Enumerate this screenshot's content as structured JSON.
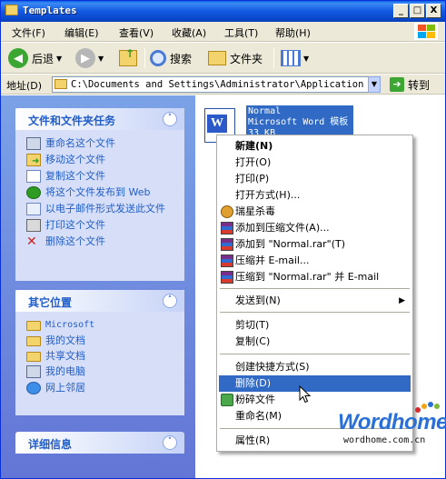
{
  "window": {
    "title": "Templates",
    "minimize": "_",
    "maximize": "□",
    "close": "X"
  },
  "menubar": [
    {
      "label": "文件(F)"
    },
    {
      "label": "编辑(E)"
    },
    {
      "label": "查看(V)"
    },
    {
      "label": "收藏(A)"
    },
    {
      "label": "工具(T)"
    },
    {
      "label": "帮助(H)"
    }
  ],
  "toolbar": {
    "back": "后退",
    "search": "搜索",
    "folders": "文件夹"
  },
  "address": {
    "label": "地址(D)",
    "value": "C:\\Documents and Settings\\Administrator\\Application Data\\Microsoft\\Templates",
    "go": "转到"
  },
  "left": {
    "tasks": {
      "title": "文件和文件夹任务",
      "items": [
        {
          "label": "重命名这个文件"
        },
        {
          "label": "移动这个文件"
        },
        {
          "label": "复制这个文件"
        },
        {
          "label": "将这个文件发布到 Web"
        },
        {
          "label": "以电子邮件形式发送此文件"
        },
        {
          "label": "打印这个文件"
        },
        {
          "label": "删除这个文件"
        }
      ]
    },
    "places": {
      "title": "其它位置",
      "items": [
        {
          "label": "Microsoft"
        },
        {
          "label": "我的文档"
        },
        {
          "label": "共享文档"
        },
        {
          "label": "我的电脑"
        },
        {
          "label": "网上邻居"
        }
      ]
    },
    "details": {
      "title": "详细信息"
    }
  },
  "file": {
    "name": "Normal",
    "type": "Microsoft Word 模板",
    "size": "33 KB"
  },
  "context_menu": {
    "items": [
      {
        "label": "新建(N)"
      },
      {
        "label": "打开(O)"
      },
      {
        "label": "打印(P)"
      },
      {
        "label": "打开方式(H)..."
      },
      {
        "label": "瑞星杀毒"
      },
      {
        "label": "添加到压缩文件(A)..."
      },
      {
        "label": "添加到 \"Normal.rar\"(T)"
      },
      {
        "label": "压缩并 E-mail..."
      },
      {
        "label": "压缩到 \"Normal.rar\" 并 E-mail"
      },
      {
        "label": "发送到(N)"
      },
      {
        "label": "剪切(T)"
      },
      {
        "label": "复制(C)"
      },
      {
        "label": "创建快捷方式(S)"
      },
      {
        "label": "删除(D)"
      },
      {
        "label": "粉碎文件"
      },
      {
        "label": "重命名(M)"
      },
      {
        "label": "属性(R)"
      }
    ],
    "selected": "删除(D)"
  },
  "watermark": {
    "brand": "Wordhome",
    "url": "wordhome.com.cn"
  },
  "colors": {
    "title_bar": "#0a5ee3",
    "selection": "#316ac5",
    "task_link": "#215dc6",
    "pane_bg": "#7ba2e7"
  }
}
